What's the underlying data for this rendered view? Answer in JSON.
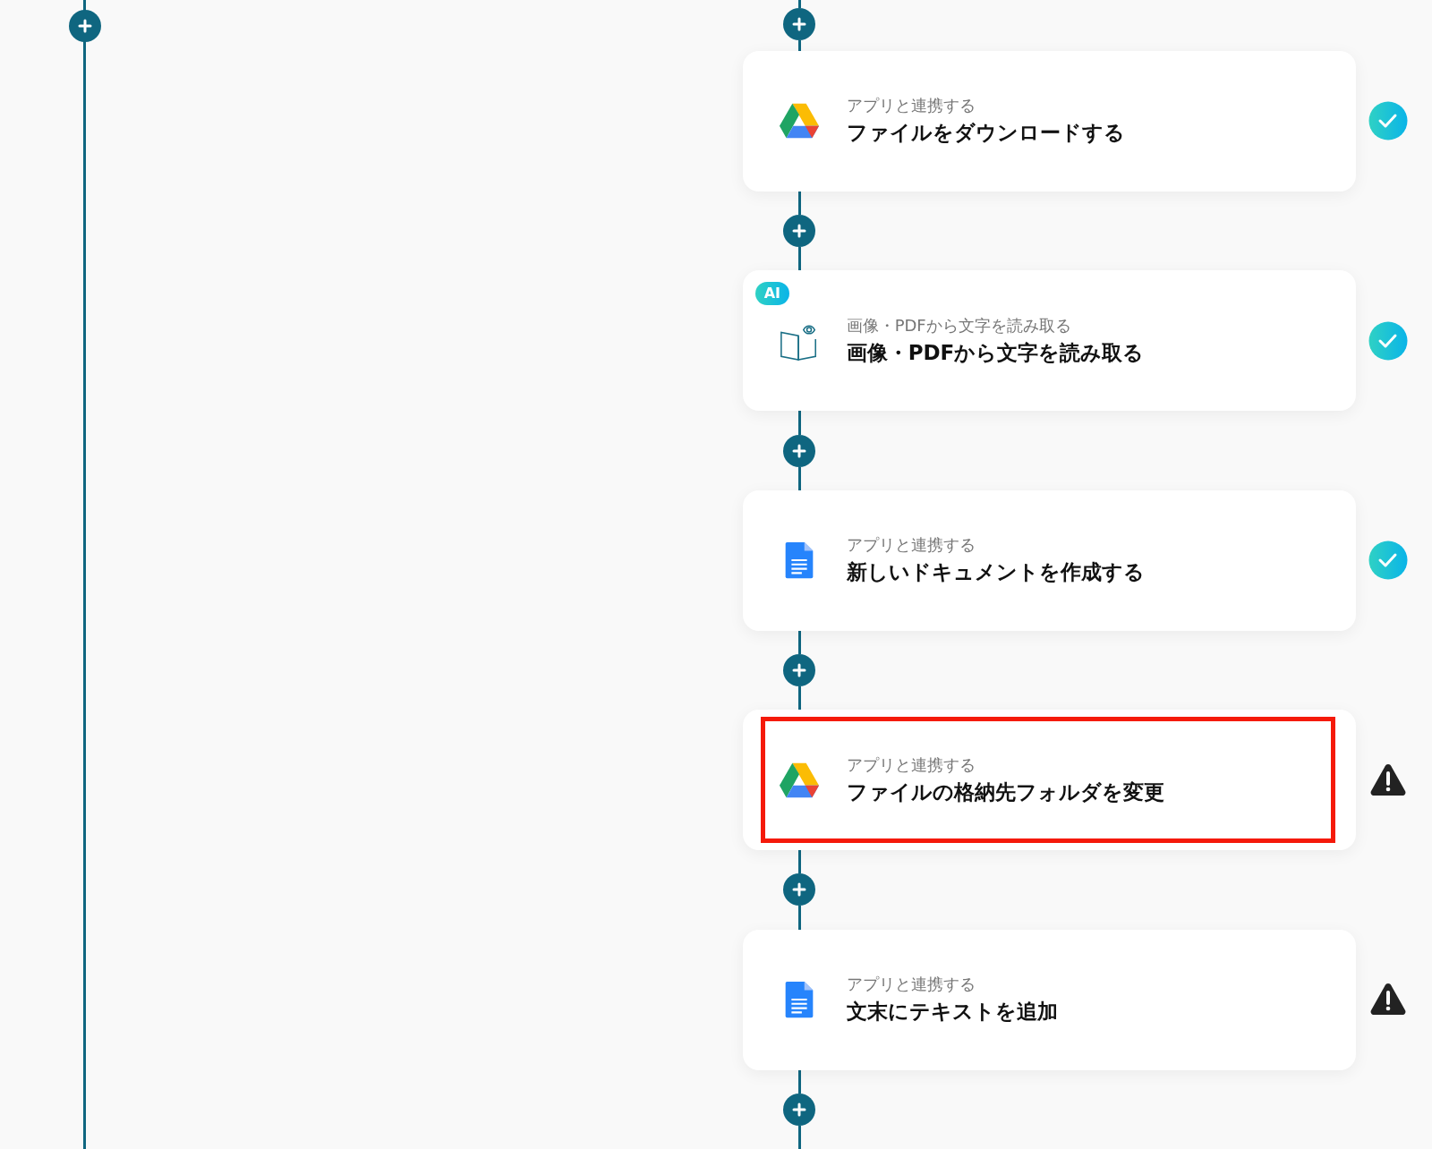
{
  "steps": [
    {
      "kind": "drive",
      "subtitle": "アプリと連携する",
      "title": "ファイルをダウンロードする",
      "completed": true,
      "highlighted": false
    },
    {
      "kind": "ocr",
      "badge": "AI",
      "subtitle": "画像・PDFから文字を読み取る",
      "title": "画像・PDFから文字を読み取る",
      "completed": true,
      "highlighted": false
    },
    {
      "kind": "docs",
      "subtitle": "アプリと連携する",
      "title": "新しいドキュメントを作成する",
      "completed": true,
      "highlighted": false
    },
    {
      "kind": "drive",
      "subtitle": "アプリと連携する",
      "title": "ファイルの格納先フォルダを変更",
      "completed": false,
      "highlighted": true
    },
    {
      "kind": "docs",
      "subtitle": "アプリと連携する",
      "title": "文末にテキストを追加",
      "completed": false,
      "highlighted": false
    }
  ]
}
